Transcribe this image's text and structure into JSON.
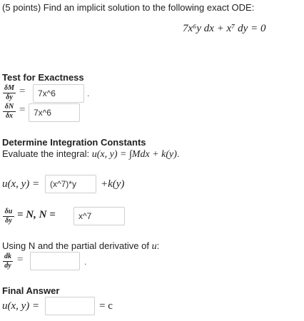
{
  "problem": {
    "prompt": "(5 points) Find an implicit solution to the following exact ODE:",
    "equation": "7x⁶y dx + x⁷ dy = 0"
  },
  "exactness": {
    "heading": "Test for Exactness",
    "dM_num": "δM",
    "dM_den": "δy",
    "dN_num": "δN",
    "dN_den": "δx",
    "equals": "=",
    "dM_value": "7x^6",
    "dN_value": "7x^6",
    "period": "."
  },
  "integration": {
    "heading": "Determine Integration Constants",
    "instruction_prefix": "Evaluate the integral: ",
    "instruction_math": "u(x, y) = ∫Mdx + k(y)",
    "instruction_suffix": ".",
    "u_label": "u(x, y) =",
    "u_value": "(x^7)*y",
    "k_term": "+k(y)",
    "du_num": "δu",
    "du_den": "δy",
    "du_eq": "= N,  N =",
    "N_value": "x^7"
  },
  "partial": {
    "instruction_prefix": "Using N and the partial derivative of ",
    "instruction_var": "u",
    "instruction_suffix": ":",
    "dk_num": "dk",
    "dk_den": "dy",
    "equals": "=",
    "dk_value": "",
    "period": "."
  },
  "final": {
    "heading": "Final Answer",
    "u_label": "u(x, y) =",
    "value": "",
    "eq_c": "= c"
  }
}
